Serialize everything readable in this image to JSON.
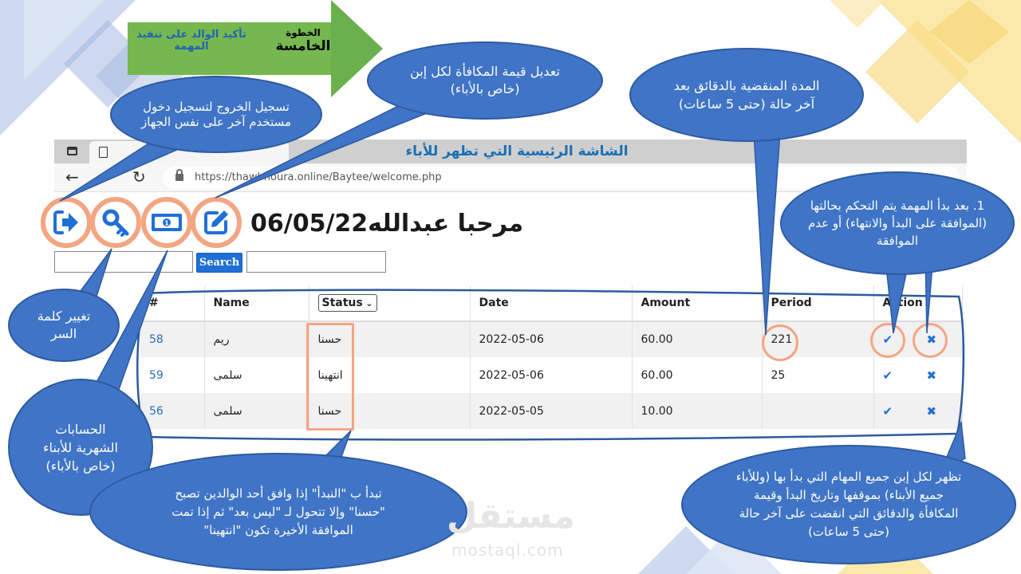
{
  "step": {
    "left_label": "تأكيد الوالد على تنفيذ المهمة",
    "step_word": "الخطوة",
    "step_number": "الخامسة"
  },
  "browser": {
    "window_title": "الشاشة الرئيسية التي تظهر للأباء",
    "url": "https://thawbnoura.online/Baytee/welcome.php"
  },
  "toolbar": {
    "icons": [
      "logout-icon",
      "key-icon",
      "money-icon",
      "edit-icon"
    ]
  },
  "welcome": {
    "greeting": "مرحبا عبدالله",
    "date": "06/05/22"
  },
  "search": {
    "button_label": "Search",
    "value_left": "",
    "value_right": ""
  },
  "table": {
    "headers": {
      "id": "#",
      "name": "Name",
      "status": "Status",
      "date": "Date",
      "amount": "Amount",
      "period": "Period",
      "action": "Action"
    },
    "rows": [
      {
        "id": "58",
        "name": "ريم",
        "status": "حسنا",
        "date": "2022-05-06",
        "amount": "60.00",
        "period": "221"
      },
      {
        "id": "59",
        "name": "سلمى",
        "status": "انتهينا",
        "date": "2022-05-06",
        "amount": "60.00",
        "period": "25"
      },
      {
        "id": "56",
        "name": "سلمى",
        "status": "حسنا",
        "date": "2022-05-05",
        "amount": "10.00",
        "period": ""
      }
    ]
  },
  "callouts": {
    "logout": "تسجيل الخروج لتسجيل دخول مستخدم آخر على نفس الجهاز",
    "reward": "تعديل قيمة المكافأة لكل إبن (خاص بالأباء)",
    "period": "المدة المنقضية بالدقائق بعد آخر حالة (حتى 5 ساعات)",
    "action": "1. بعد بدأ المهمة يتم التحكم بحالتها (الموافقة على البدأ والانتهاء) أو عدم الموافقة",
    "password": "تغيير كلمة السر",
    "accounts": "الحسابات الشهرية للأبناء (خاص بالأباء)",
    "status": "تبدأ ب \"النبدأ\" إذا وافق أحد الوالدين تصبح \"حسنا\" وإلا تتحول لـ \"ليس بعد\" ثم إذا تمت الموافقة الأخيرة تكون \"انتهينا\"",
    "tasks": "تظهر لكل إبن جميع المهام التي بدأ بها (وللأباء جميع الأبناء) بموقفها وتاريخ البدأ وقيمة المكافأة والدقائق التي انقضت على آخر حالة (حتى 5 ساعات)"
  },
  "watermark": {
    "arabic": "مستقل",
    "latin": "mostaql.com"
  },
  "colors": {
    "callout_fill": "#3f74c6",
    "highlight": "#f4a582",
    "banner_green": "#6ab04c",
    "title_blue": "#1b6fb3",
    "link_blue": "#2a6ebb"
  }
}
